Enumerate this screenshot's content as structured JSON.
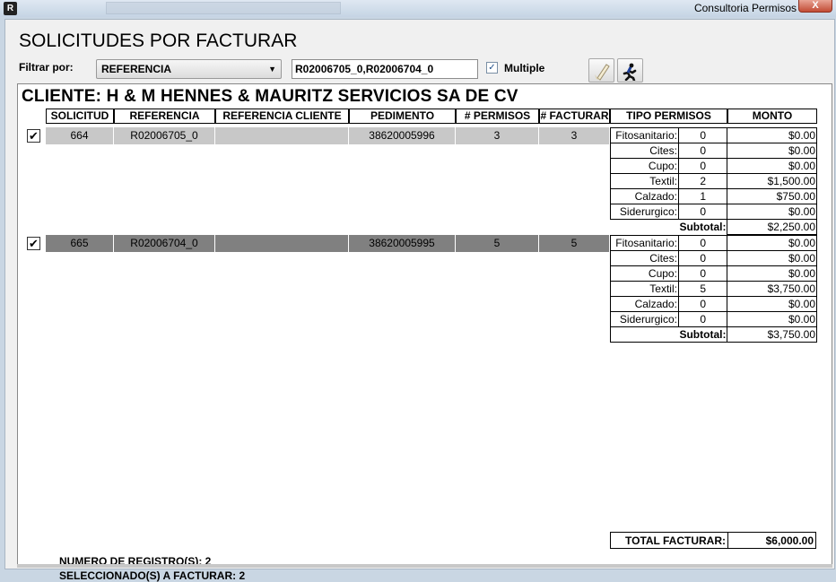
{
  "window": {
    "title": "Consultoria Permisos",
    "close": "X",
    "app_icon": "R"
  },
  "heading": "SOLICITUDES POR FACTURAR",
  "filter": {
    "label": "Filtrar por:",
    "selected": "REFERENCIA",
    "value": "R02006705_0,R02006704_0",
    "multiple_label": "Multiple",
    "multiple_checked": true
  },
  "client": "CLIENTE: H & M HENNES & MAURITZ SERVICIOS SA DE CV",
  "headers": [
    "SOLICITUD",
    "REFERENCIA",
    "REFERENCIA CLIENTE",
    "PEDIMENTO",
    "# PERMISOS",
    "# FACTURAR",
    "TIPO PERMISOS",
    "MONTO"
  ],
  "rows": [
    {
      "checked": true,
      "solicitud": "664",
      "referencia": "R02006705_0",
      "ref_cliente": "",
      "pedimento": "38620005996",
      "permisos": "3",
      "facturar": "3",
      "tipos": [
        {
          "tipo": "Fitosanitario:",
          "cantidad": "0",
          "monto": "$0.00"
        },
        {
          "tipo": "Cites:",
          "cantidad": "0",
          "monto": "$0.00"
        },
        {
          "tipo": "Cupo:",
          "cantidad": "0",
          "monto": "$0.00"
        },
        {
          "tipo": "Textil:",
          "cantidad": "2",
          "monto": "$1,500.00"
        },
        {
          "tipo": "Calzado:",
          "cantidad": "1",
          "monto": "$750.00"
        },
        {
          "tipo": "Siderurgico:",
          "cantidad": "0",
          "monto": "$0.00"
        }
      ],
      "subtotal_label": "Subtotal:",
      "subtotal": "$2,250.00"
    },
    {
      "checked": true,
      "solicitud": "665",
      "referencia": "R02006704_0",
      "ref_cliente": "",
      "pedimento": "38620005995",
      "permisos": "5",
      "facturar": "5",
      "tipos": [
        {
          "tipo": "Fitosanitario:",
          "cantidad": "0",
          "monto": "$0.00"
        },
        {
          "tipo": "Cites:",
          "cantidad": "0",
          "monto": "$0.00"
        },
        {
          "tipo": "Cupo:",
          "cantidad": "0",
          "monto": "$0.00"
        },
        {
          "tipo": "Textil:",
          "cantidad": "5",
          "monto": "$3,750.00"
        },
        {
          "tipo": "Calzado:",
          "cantidad": "0",
          "monto": "$0.00"
        },
        {
          "tipo": "Siderurgico:",
          "cantidad": "0",
          "monto": "$0.00"
        }
      ],
      "subtotal_label": "Subtotal:",
      "subtotal": "$3,750.00"
    }
  ],
  "footer": {
    "registros": "NUMERO DE REGISTRO(S): 2",
    "seleccionados": "SELECCIONADO(S) A FACTURAR: 2",
    "total_label": "TOTAL FACTURAR:",
    "total": "$6,000.00"
  },
  "colors": {
    "row_light": "#c8c8c8",
    "row_dark": "#808080"
  }
}
